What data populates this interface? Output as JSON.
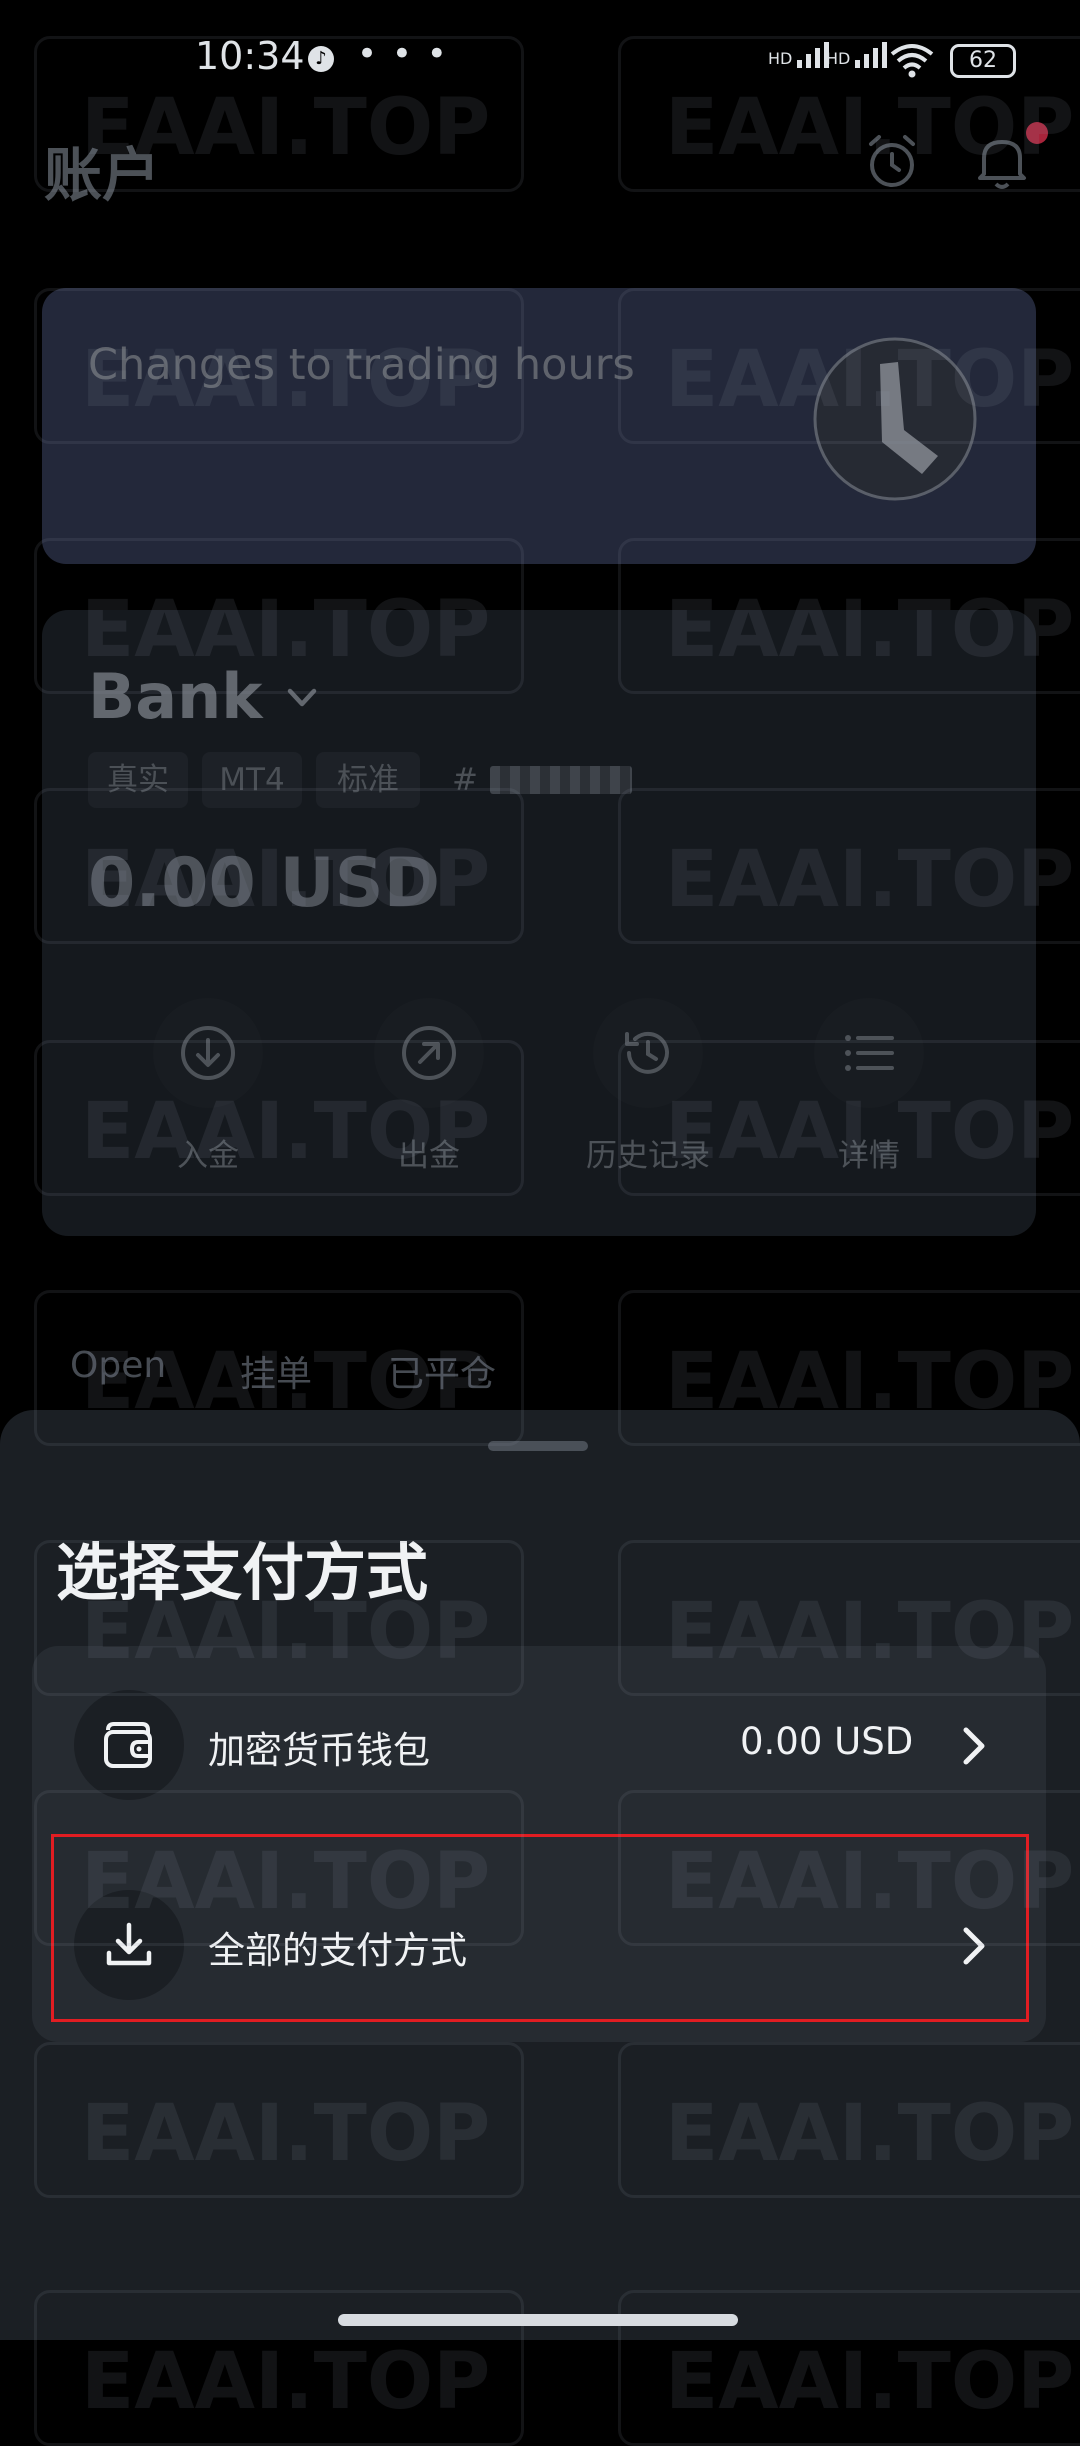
{
  "status_bar": {
    "time": "10:34",
    "more": "• • •",
    "signal1": "HD",
    "signal2": "HD",
    "battery": "62"
  },
  "header": {
    "title": "账户"
  },
  "banner": {
    "text": "Changes to trading hours"
  },
  "account": {
    "name": "Bank",
    "tags": [
      "真实",
      "MT4",
      "标准"
    ],
    "number_prefix": "#",
    "balance": "0.00 USD",
    "actions": [
      {
        "label": "入金",
        "icon": "deposit-icon"
      },
      {
        "label": "出金",
        "icon": "withdraw-icon"
      },
      {
        "label": "历史记录",
        "icon": "history-icon"
      },
      {
        "label": "详情",
        "icon": "details-icon"
      }
    ]
  },
  "tabs": [
    "Open",
    "挂单",
    "已平仓"
  ],
  "sheet": {
    "title": "选择支付方式",
    "options": [
      {
        "label": "加密货币钱包",
        "amount": "0.00 USD",
        "icon": "wallet-icon"
      },
      {
        "label": "全部的支付方式",
        "amount": "",
        "icon": "download-icon"
      }
    ]
  },
  "watermark": "EAAI.TOP",
  "colors": {
    "background": "#000000",
    "sheet": "#1b1f24",
    "panel": "#262b31",
    "highlight": "#e11d22",
    "notification_dot": "#a8243b"
  }
}
